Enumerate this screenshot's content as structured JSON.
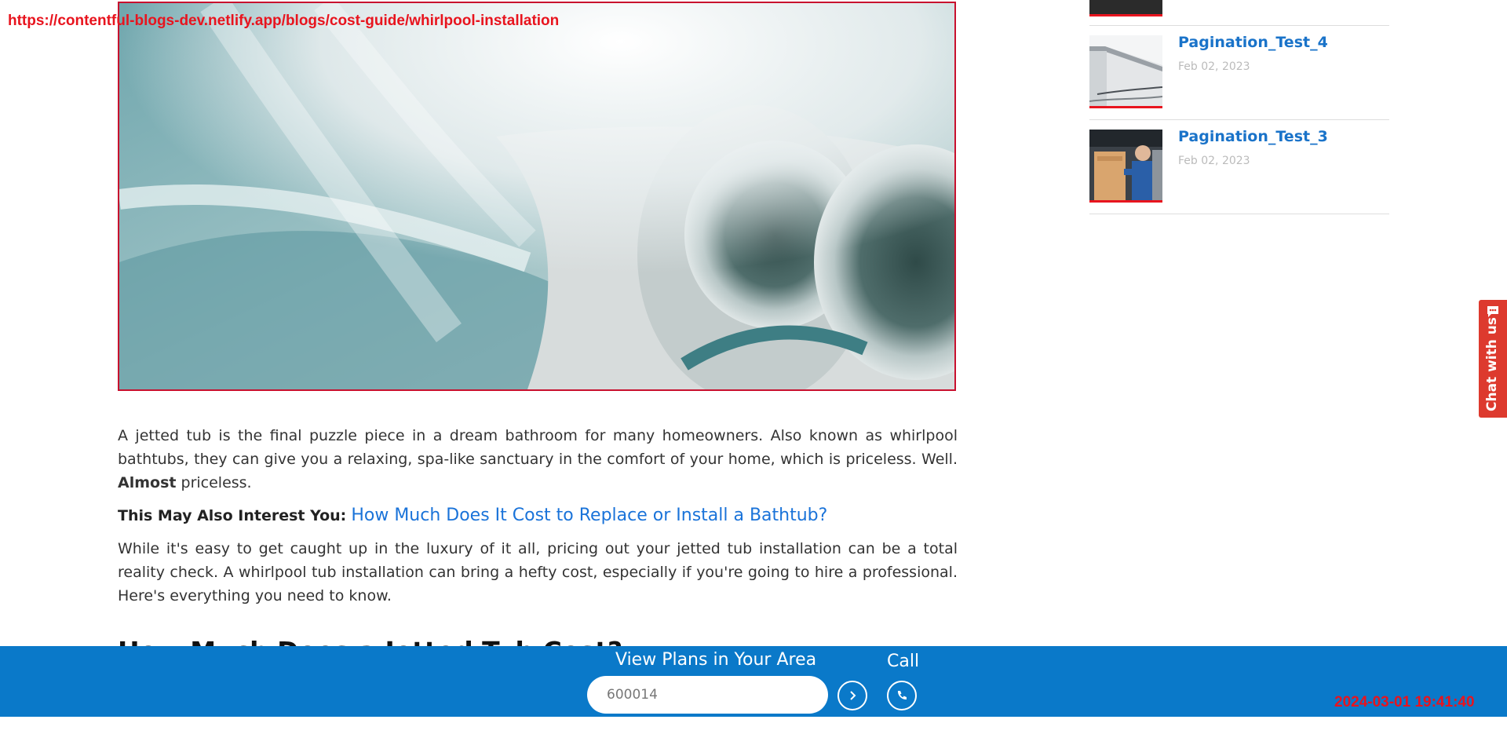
{
  "browser": {
    "url": "https://contentful-blogs-dev.netlify.app/blogs/cost-guide/whirlpool-installation",
    "timestamp": "2024-03-01 19:41:40"
  },
  "hero": {
    "icon": "jetted-tub-photo"
  },
  "article": {
    "p1_main": "A jetted tub is the final puzzle piece in a dream bathroom for many homeowners. Also known as whirlpool bathtubs, they can give you a relaxing, spa-like sanctuary in the comfort of your home, which is priceless. Well. ",
    "p1_bold": "Almost",
    "p1_end": " priceless.",
    "interest_lead": "This May Also Interest You:",
    "interest_link": "How Much Does It Cost to Replace or Install a Bathtub?",
    "p2": "While it's easy to get caught up in the luxury of it all, pricing out your jetted tub installation can be a total reality check. A whirlpool tub installation can bring a hefty cost, especially if you're going to hire a professional. Here's everything you need to know.",
    "heading": "How Much Does a Jetted Tub Cost?"
  },
  "sidebar": {
    "items": [
      {
        "title": "Pagination_Test_4",
        "date": "Feb 02, 2023",
        "thumb_icon": "house-roof-photo"
      },
      {
        "title": "Pagination_Test_3",
        "date": "Feb 02, 2023",
        "thumb_icon": "technician-photo"
      }
    ]
  },
  "chat": {
    "label": "Chat with us",
    "icon": "chat-bubble-icon"
  },
  "bottom_bar": {
    "plans_label": "View Plans in Your Area",
    "zip_value": "600014",
    "call_label": "Call",
    "go_icon": "chevron-right-icon",
    "call_icon": "phone-icon"
  },
  "colors": {
    "bar_blue": "#0a79c9",
    "link_blue": "#1a73d9",
    "accent_red": "#e8141e"
  }
}
